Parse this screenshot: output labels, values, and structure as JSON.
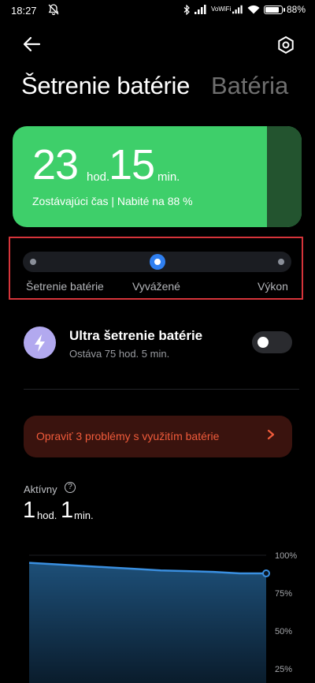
{
  "status_bar": {
    "time": "18:27",
    "network": "VoWiFi",
    "battery_percent": "88%",
    "battery_level": 0.88
  },
  "header": {
    "title": "Šetrenie batérie",
    "tab_secondary": "Batéria"
  },
  "battery_card": {
    "hours": "23",
    "hours_unit": "hod.",
    "minutes": "15",
    "minutes_unit": "min.",
    "remaining_text": "Zostávajúci čas | Nabité na 88 %",
    "color": "#3ecf6a"
  },
  "mode_slider": {
    "options": [
      "Šetrenie batérie",
      "Vyvážené",
      "Výkon"
    ],
    "selected": "Vyvážené",
    "accent": "#2f7ff0"
  },
  "ultra_saver": {
    "title": "Ultra šetrenie batérie",
    "subtitle": "Ostáva 75 hod. 5 min.",
    "enabled": false
  },
  "fix_banner": {
    "text": "Opraviť 3 problémy s využitím batérie",
    "color": "#f05b3b"
  },
  "active": {
    "label": "Aktívny",
    "hours": "1",
    "hours_unit": "hod.",
    "minutes": "1",
    "minutes_unit": "min."
  },
  "chart_data": {
    "type": "area",
    "y_ticks": [
      "100%",
      "75%",
      "50%",
      "25%"
    ],
    "ylim": [
      0,
      100
    ],
    "values": [
      95,
      94,
      93,
      92,
      91,
      90,
      89.5,
      89,
      88,
      88
    ],
    "line_color": "#3a8fe0"
  }
}
